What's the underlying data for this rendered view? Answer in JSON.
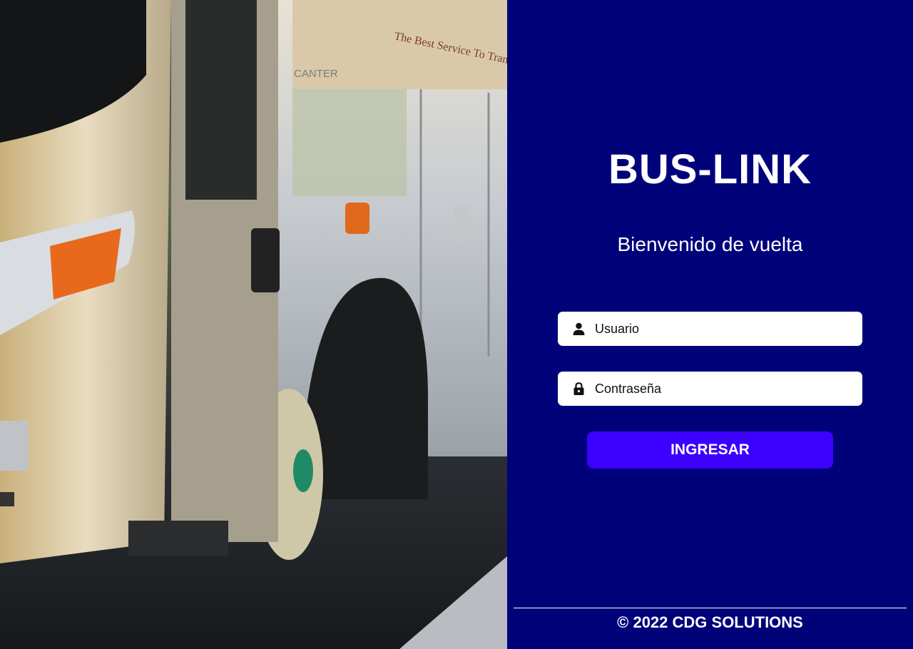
{
  "brand": {
    "title": "BUS-LINK"
  },
  "welcome": {
    "text": "Bienvenido de vuelta"
  },
  "login": {
    "username": {
      "placeholder": "Usuario",
      "value": "",
      "icon": "user-icon"
    },
    "password": {
      "placeholder": "Contraseña",
      "value": "",
      "icon": "lock-icon"
    },
    "submit_label": "INGRESAR"
  },
  "footer": {
    "text": "© 2022 CDG SOLUTIONS"
  },
  "hero": {
    "bus_lettering": "The Best Service To Transport",
    "bus_model": "CANTER"
  },
  "colors": {
    "panel_bg": "#00027a",
    "button_bg": "#3c00ff",
    "text": "#ffffff"
  }
}
